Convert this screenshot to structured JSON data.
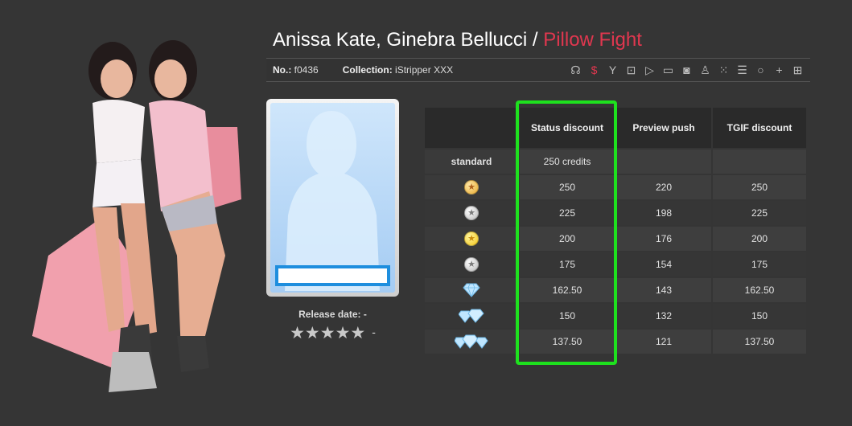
{
  "header": {
    "performers": "Anissa Kate, Ginebra Bellucci",
    "separator": " / ",
    "scene_title": "Pillow Fight"
  },
  "info": {
    "number_label": "No.:",
    "number_value": "f0436",
    "collection_label": "Collection:",
    "collection_value": "iStripper XXX"
  },
  "toolbar": {
    "icons": [
      "profile-icon",
      "dollar-icon",
      "filter-icon",
      "lock-icon",
      "play-icon",
      "comment-icon",
      "camera-icon",
      "group-icon",
      "grid-icon",
      "list-icon",
      "circle-icon",
      "plus-icon",
      "apps-icon"
    ],
    "active": "dollar-icon",
    "active_color": "#e0374f"
  },
  "card": {
    "release_label": "Release date:",
    "release_value": "-",
    "rating_stars": "★★★★★",
    "rating_value": "-"
  },
  "pricing": {
    "columns": [
      "",
      "Status discount",
      "Preview push",
      "TGIF discount"
    ],
    "standard": {
      "label": "standard",
      "status": "250 credits",
      "preview": "",
      "tgif": ""
    },
    "rows": [
      {
        "badge": "gold-medal-icon",
        "status": "250",
        "preview": "220",
        "tgif": "250"
      },
      {
        "badge": "silver-medal-icon",
        "status": "225",
        "preview": "198",
        "tgif": "225"
      },
      {
        "badge": "yellow-medal-icon",
        "status": "200",
        "preview": "176",
        "tgif": "200"
      },
      {
        "badge": "silver-medal-icon",
        "status": "175",
        "preview": "154",
        "tgif": "175"
      },
      {
        "badge": "diamond-1-icon",
        "status": "162.50",
        "preview": "143",
        "tgif": "162.50"
      },
      {
        "badge": "diamond-2-icon",
        "status": "150",
        "preview": "132",
        "tgif": "150"
      },
      {
        "badge": "diamond-3-icon",
        "status": "137.50",
        "preview": "121",
        "tgif": "137.50"
      }
    ],
    "highlight_color": "#1ee11e"
  }
}
